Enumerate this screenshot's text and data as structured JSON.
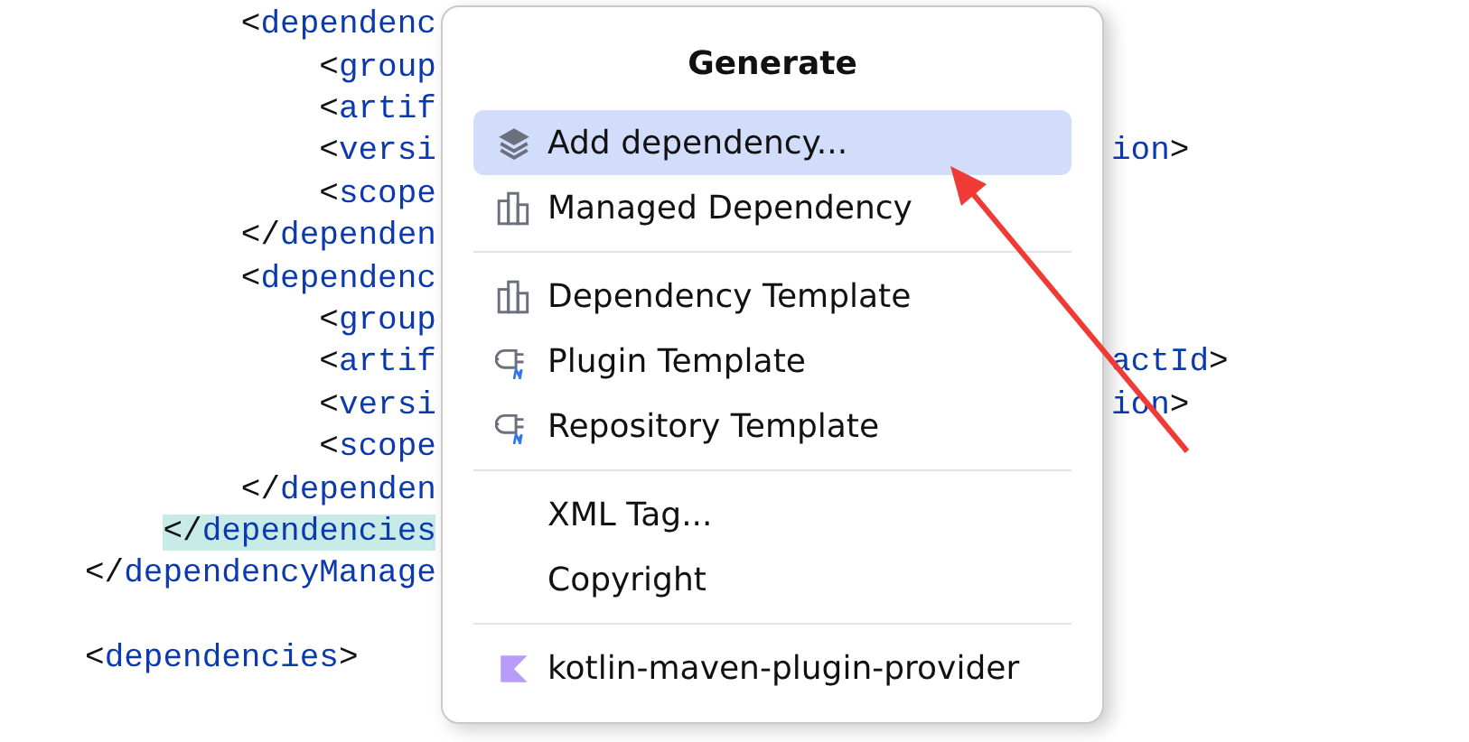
{
  "editor": {
    "lines": [
      {
        "text": "        <dependenc"
      },
      {
        "text": "            <group"
      },
      {
        "text": "            <artif"
      },
      {
        "text": "            <versi",
        "right": "ion>"
      },
      {
        "text": "            <scope"
      },
      {
        "text": "        </dependen"
      },
      {
        "text": "        <dependenc"
      },
      {
        "text": "            <group"
      },
      {
        "text": "            <artif",
        "right": "actId>"
      },
      {
        "text": "            <versi",
        "right": "ion>"
      },
      {
        "text": "            <scope"
      },
      {
        "text": "        </dependen"
      },
      {
        "text": "    </dependencies",
        "highlighted": true
      },
      {
        "text": "</dependencyManage"
      },
      {
        "kind": "blank"
      },
      {
        "text": "<dependencies>"
      }
    ]
  },
  "popup": {
    "title": "Generate",
    "groups": [
      [
        {
          "label": "Add dependency...",
          "kind": "layers",
          "selected": true
        },
        {
          "label": "Managed Dependency",
          "kind": "bars",
          "selected": false
        }
      ],
      [
        {
          "label": "Dependency Template",
          "kind": "bars",
          "selected": false
        },
        {
          "label": "Plugin Template",
          "kind": "plug",
          "selected": false
        },
        {
          "label": "Repository Template",
          "kind": "plug",
          "selected": false
        }
      ],
      [
        {
          "label": "XML Tag...",
          "kind": "plain",
          "selected": false
        },
        {
          "label": "Copyright",
          "kind": "plain",
          "selected": false
        }
      ],
      [
        {
          "label": "kotlin-maven-plugin-provider",
          "kind": "kotlin",
          "selected": false
        }
      ]
    ]
  }
}
